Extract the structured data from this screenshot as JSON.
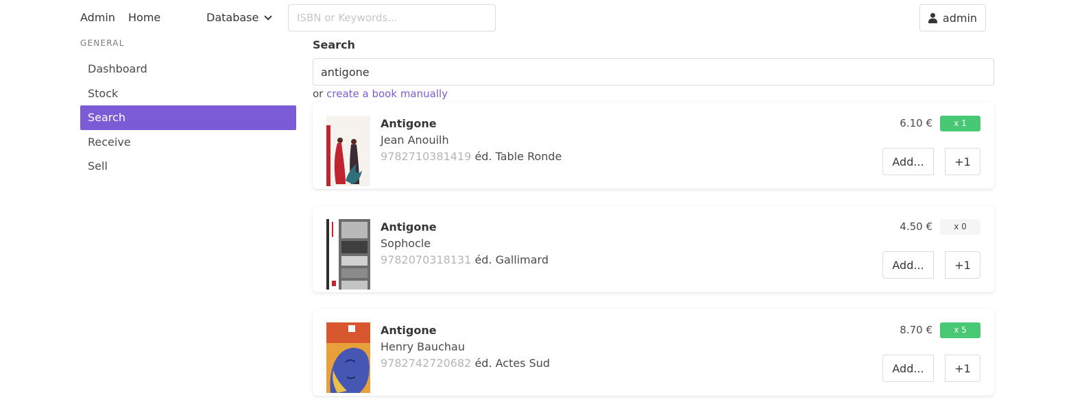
{
  "navbar": {
    "admin_label": "Admin",
    "home_label": "Home",
    "database_label": "Database",
    "search_placeholder": "ISBN or Keywords...",
    "user_label": "admin"
  },
  "sidebar": {
    "section_label": "GENERAL",
    "items": [
      {
        "label": "Dashboard",
        "active": false
      },
      {
        "label": "Stock",
        "active": false
      },
      {
        "label": "Search",
        "active": true
      },
      {
        "label": "Receive",
        "active": false
      },
      {
        "label": "Sell",
        "active": false
      }
    ]
  },
  "main": {
    "search_label": "Search",
    "search_value": "antigone",
    "create_prefix": "or",
    "create_link": "create a book manually",
    "add_label": "Add...",
    "plus_label": "+1",
    "results": [
      {
        "title": "Antigone",
        "author": "Jean Anouilh",
        "isbn": "9782710381419",
        "publisher": "éd. Table Ronde",
        "price": "6.10 €",
        "stock": "x 1",
        "in_stock": true
      },
      {
        "title": "Antigone",
        "author": "Sophocle",
        "isbn": "9782070318131",
        "publisher": "éd. Gallimard",
        "price": "4.50 €",
        "stock": "x 0",
        "in_stock": false
      },
      {
        "title": "Antigone",
        "author": "Henry Bauchau",
        "isbn": "9782742720682",
        "publisher": "éd. Actes Sud",
        "price": "8.70 €",
        "stock": "x 5",
        "in_stock": true
      }
    ]
  },
  "colors": {
    "accent": "#7b5bd6",
    "stock_available": "#48c774",
    "stock_empty": "#f5f5f5"
  }
}
